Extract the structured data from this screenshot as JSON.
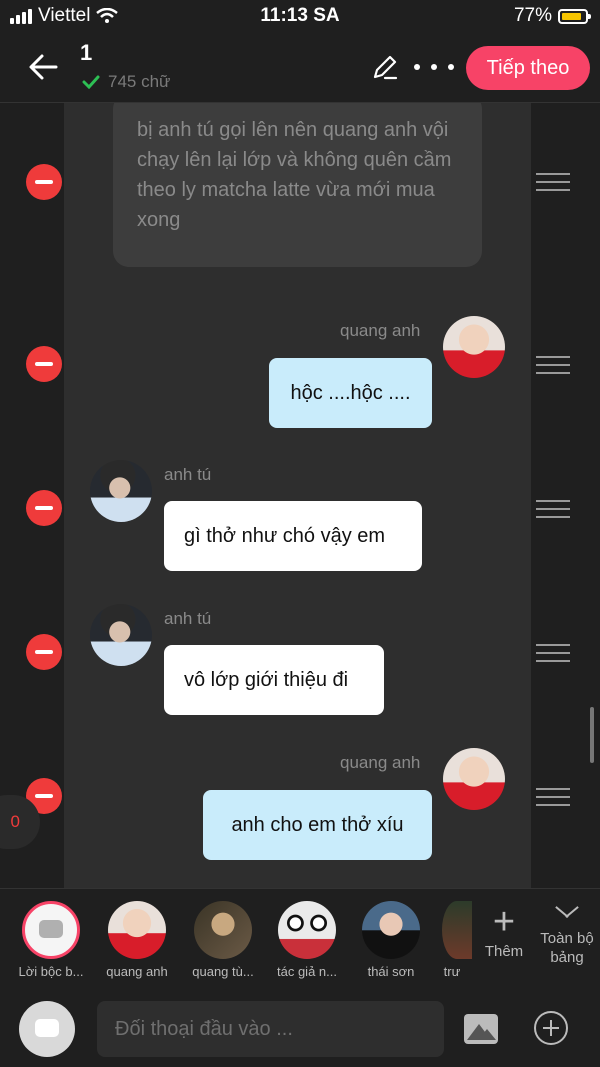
{
  "status_bar": {
    "carrier": "Viettel",
    "time": "11:13 SA",
    "battery": "77%"
  },
  "header": {
    "title": "1",
    "word_count": "745 chữ",
    "next_label": "Tiếp theo"
  },
  "messages": {
    "narration": "bị anh tú gọi lên nên quang anh vội chạy lên lại lớp và không quên cầm theo ly matcha latte vừa mới mua xong",
    "m1": {
      "sender": "quang anh",
      "text": "hộc ....hộc ...."
    },
    "m2": {
      "sender": "anh tú",
      "text": "gì thở như chó vậy em"
    },
    "m3": {
      "sender": "anh tú",
      "text": "vô lớp giới thiệu đi"
    },
    "m4": {
      "sender": "quang anh",
      "text": "anh cho em thở xíu"
    }
  },
  "counter": "0",
  "characters": [
    {
      "label": "Lời bộc b..."
    },
    {
      "label": "quang anh"
    },
    {
      "label": "quang tù..."
    },
    {
      "label": "tác giả n..."
    },
    {
      "label": "thái sơn"
    },
    {
      "label": "trư"
    }
  ],
  "char_actions": {
    "add_more": "Thêm",
    "full_board": "Toàn bộ bảng"
  },
  "input": {
    "placeholder": "Đối thoại đầu vào ..."
  },
  "colors": {
    "accent": "#f74367",
    "remove": "#ef3b3b",
    "bubble_blue": "#c9ecfb"
  }
}
